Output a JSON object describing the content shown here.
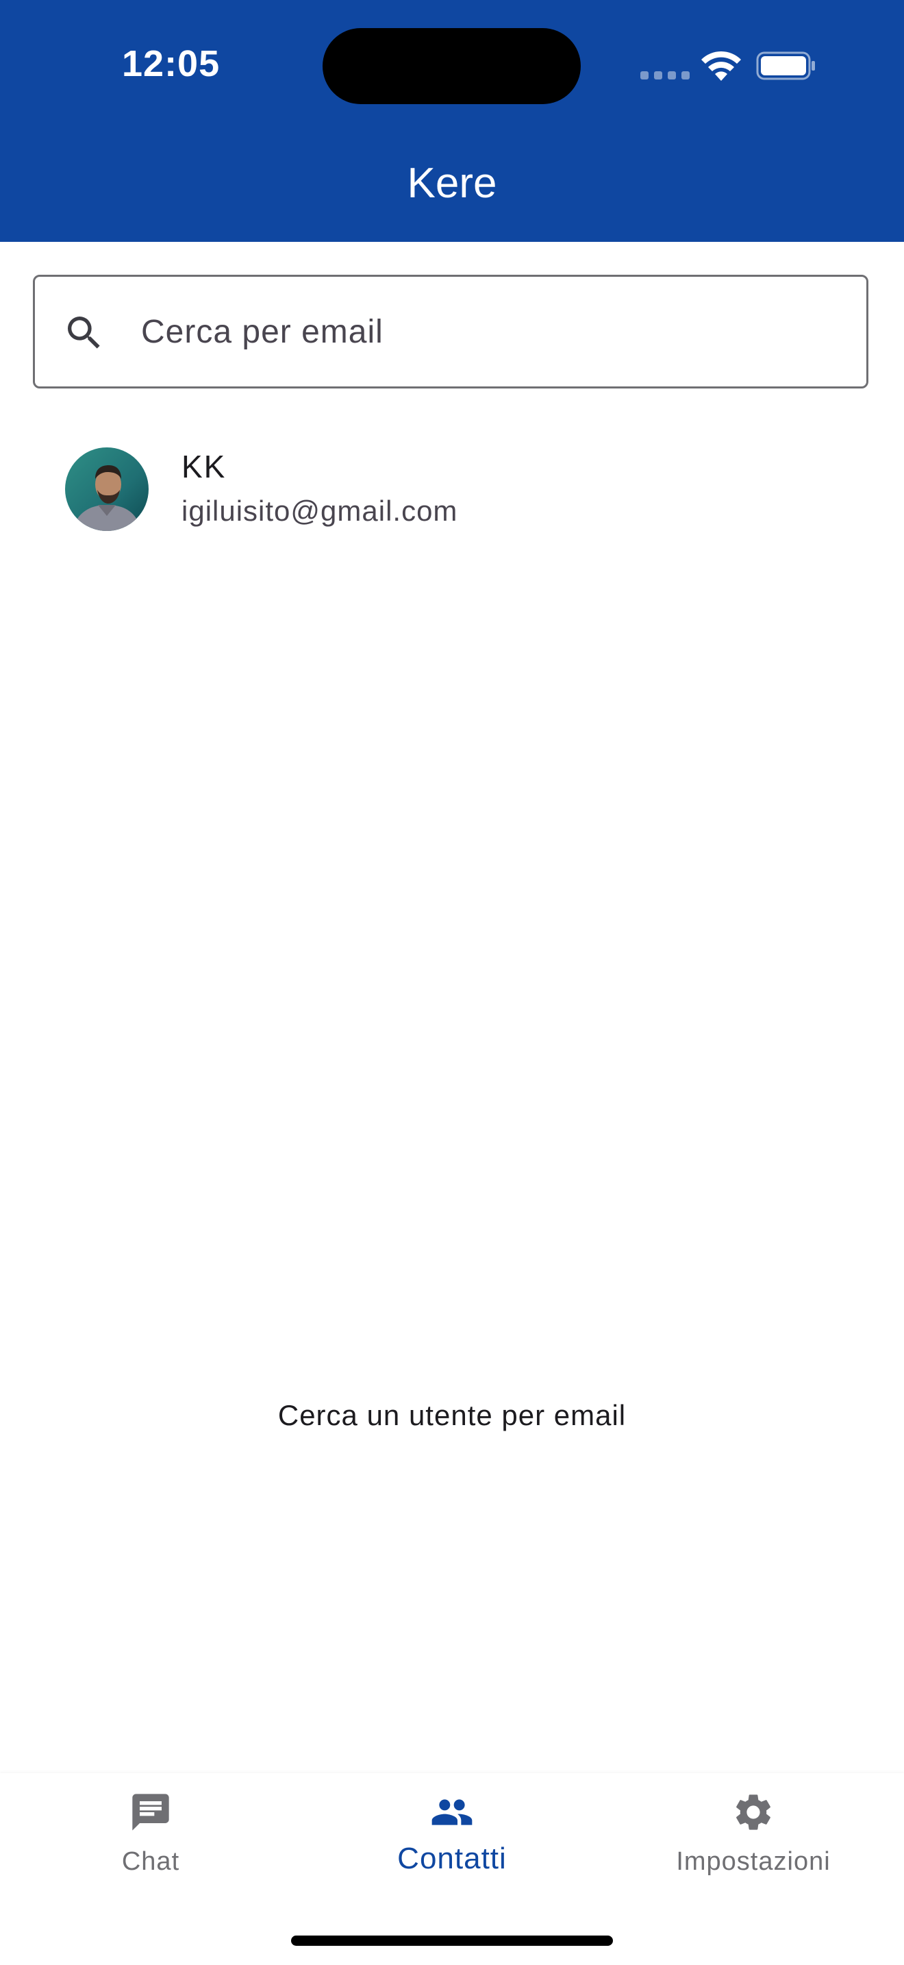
{
  "status_bar": {
    "time": "12:05"
  },
  "header": {
    "title": "Kere",
    "background_color": "#0f47a1"
  },
  "search": {
    "placeholder": "Cerca per email",
    "value": "",
    "icon": "search-icon"
  },
  "contacts": [
    {
      "name": "KK",
      "email": "igiluisito@gmail.com",
      "avatar": "avatar-photo"
    }
  ],
  "empty_hint": "Cerca un utente per email",
  "bottom_nav": {
    "active_color": "#0f47a1",
    "inactive_color": "#6f6f73",
    "items": [
      {
        "label": "Chat",
        "icon": "chat-icon",
        "active": false
      },
      {
        "label": "Contatti",
        "icon": "people-icon",
        "active": true
      },
      {
        "label": "Impostazioni",
        "icon": "gear-icon",
        "active": false
      }
    ]
  }
}
